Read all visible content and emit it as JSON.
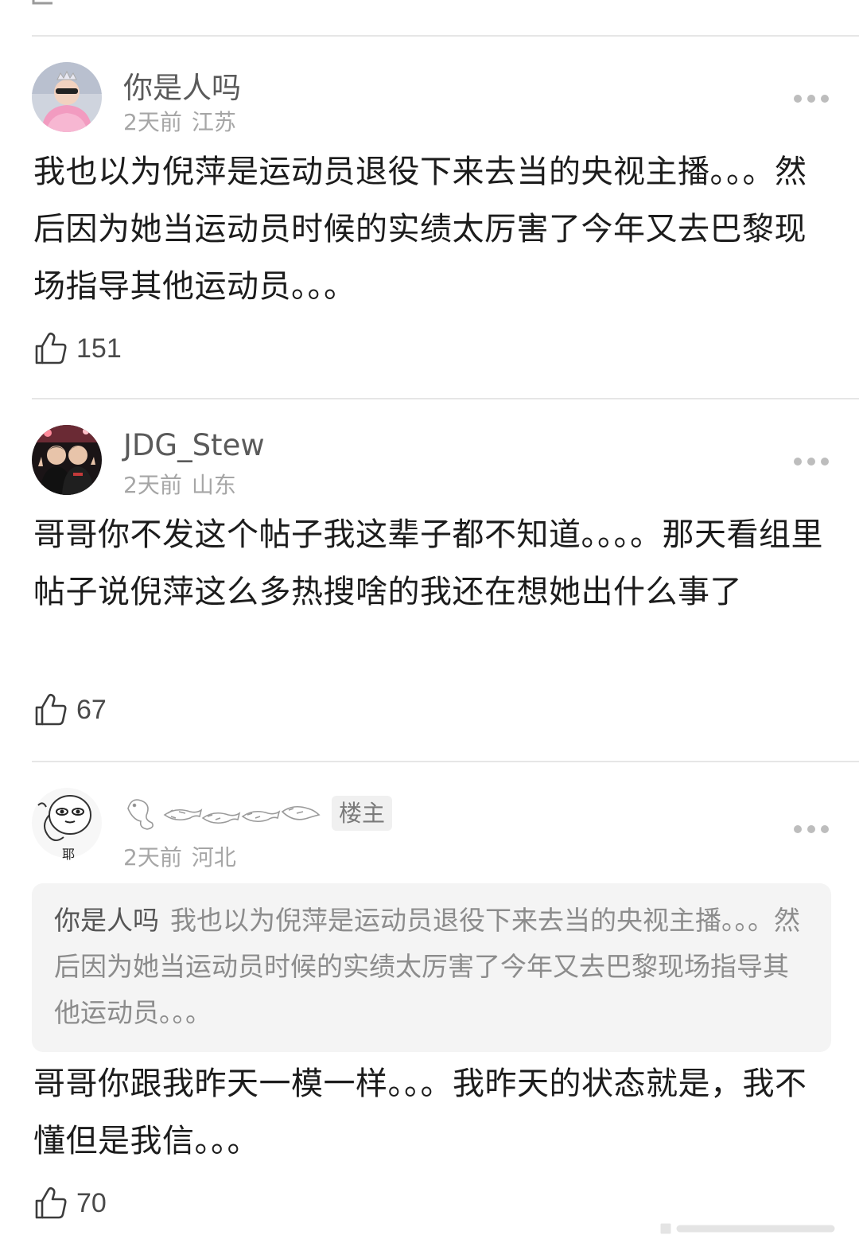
{
  "comments": [
    {
      "username": "你是人吗",
      "time": "2天前",
      "location": "江苏",
      "text": "我也以为倪萍是运动员退役下来去当的央视主播。。。然后因为她当运动员时候的实绩太厉害了今年又去巴黎现场指导其他运动员。。。",
      "likes": "151",
      "avatar_icon": "girl-crown-avatar-icon"
    },
    {
      "username": "JDG_Stew",
      "time": "2天前",
      "location": "山东",
      "text": "哥哥你不发这个帖子我这辈子都不知道。。。。那天看组里帖子说倪萍这么多热搜啥的我还在想她出什么事了",
      "likes": "67",
      "avatar_icon": "two-people-avatar-icon"
    },
    {
      "username_icon": "fish-drawing-username",
      "badge": "楼主",
      "time": "2天前",
      "location": "河北",
      "quote_user": "你是人吗",
      "quote_text": "我也以为倪萍是运动员退役下来去当的央视主播。。。然后因为她当运动员时候的实绩太厉害了今年又去巴黎现场指导其他运动员。。。",
      "text": "哥哥你跟我昨天一模一样。。。我昨天的状态就是，我不懂但是我信。。。",
      "likes": "70",
      "avatar_icon": "meme-face-avatar-icon",
      "avatar_caption": "耶"
    }
  ],
  "colors": {
    "divider": "#e6e6e6",
    "username": "#5a5a5a",
    "meta": "#a6a6a6",
    "quote_bg": "#f4f4f4"
  }
}
